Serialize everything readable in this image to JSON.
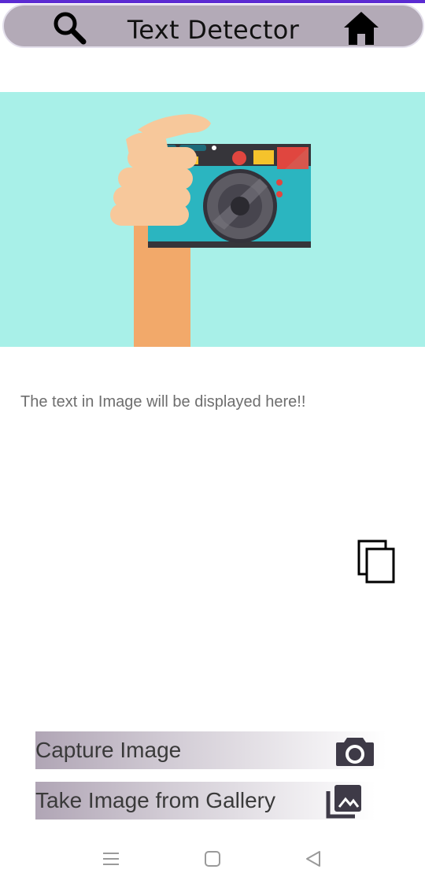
{
  "app_bar": {
    "title": "Text Detector",
    "search_icon": "search-icon",
    "home_icon": "home-icon"
  },
  "hero": {
    "illustration": "hand-holding-camera-illustration",
    "background_color": "#a8f0e8"
  },
  "result": {
    "placeholder_text": "The text in Image will be displayed here!!"
  },
  "copy": {
    "icon": "copy-icon"
  },
  "actions": {
    "capture_label": "Capture Image",
    "capture_icon": "camera-icon",
    "gallery_label": "Take Image from Gallery",
    "gallery_icon": "photo-library-icon"
  },
  "system_nav": {
    "menu_icon": "recents-icon",
    "home_icon": "home-square-icon",
    "back_icon": "back-triangle-icon"
  }
}
